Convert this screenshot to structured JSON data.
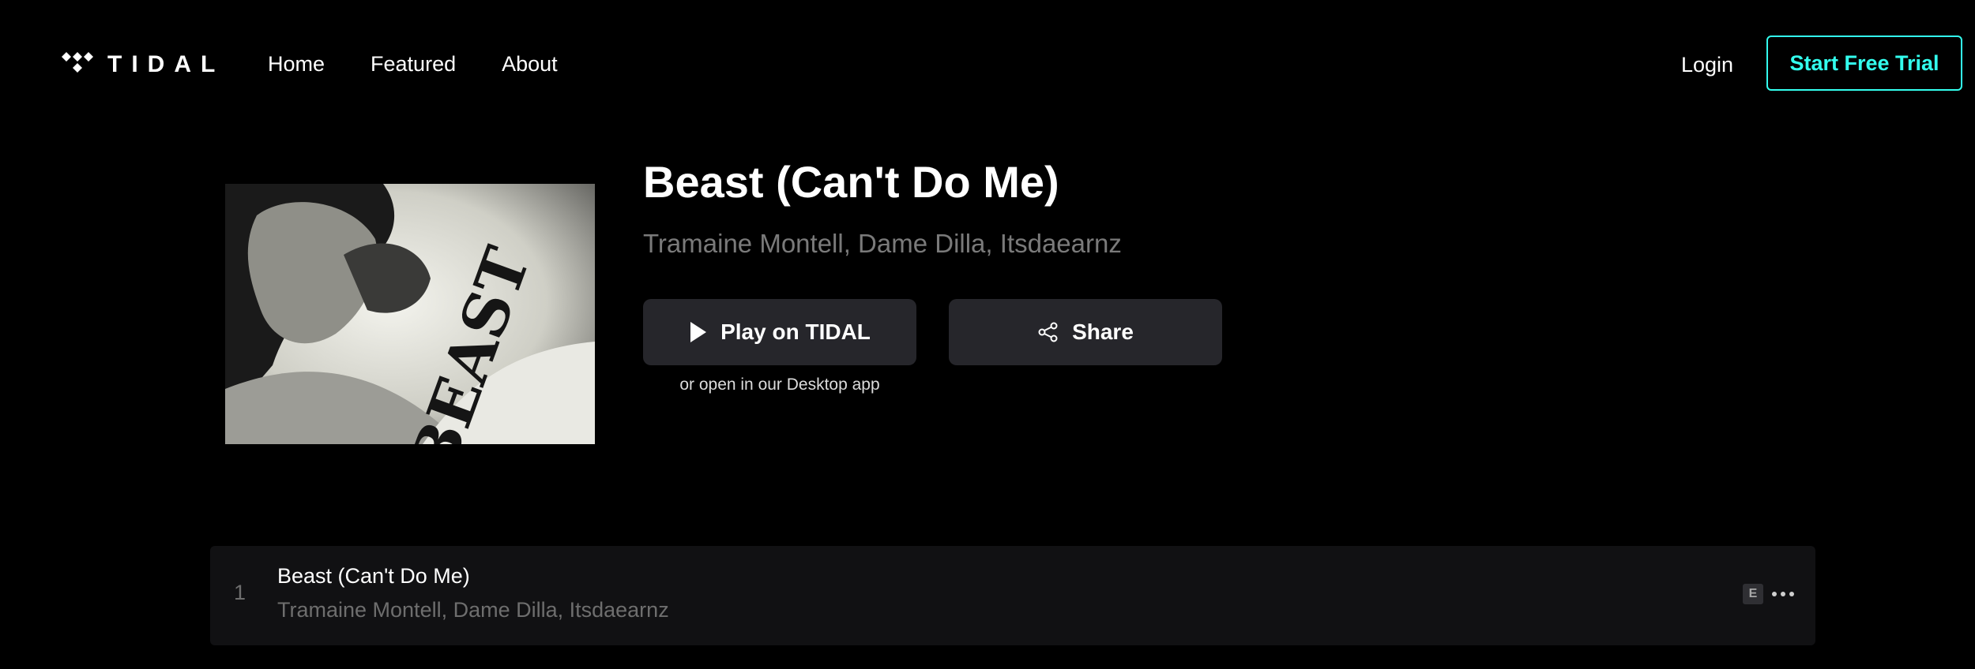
{
  "header": {
    "logo_text": "TIDAL",
    "nav": [
      {
        "label": "Home"
      },
      {
        "label": "Featured"
      },
      {
        "label": "About"
      }
    ],
    "login_label": "Login",
    "trial_label": "Start Free Trial",
    "accent_color": "#33ffee"
  },
  "album": {
    "cover_text": "BEAST",
    "title": "Beast (Can't Do Me)",
    "artists": "Tramaine Montell, Dame Dilla, Itsdaearnz",
    "play_label": "Play on TIDAL",
    "share_label": "Share",
    "desktop_note": "or open in our Desktop app"
  },
  "tracks": [
    {
      "number": "1",
      "title": "Beast (Can't Do Me)",
      "artists": "Tramaine Montell, Dame Dilla, Itsdaearnz",
      "explicit": "E"
    }
  ],
  "icons": {
    "logo": "tidal-logo-icon",
    "play": "play-icon",
    "share": "share-icon",
    "more": "more-options-icon"
  }
}
